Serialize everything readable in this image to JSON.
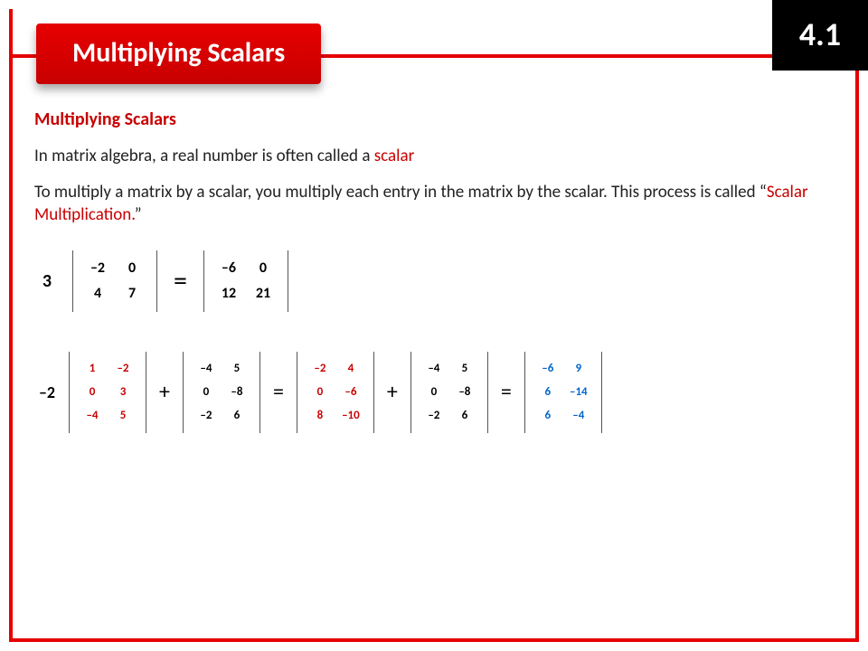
{
  "header": {
    "title": "Multiplying Scalars",
    "section": "4.1"
  },
  "content": {
    "subhead": "Multiplying Scalars",
    "para1_a": "In matrix algebra, a real number is often called a ",
    "para1_scalar": "scalar",
    "para2_a": "To multiply a matrix by a scalar, you multiply each entry in the matrix by the scalar.  This process is called “",
    "para2_term": "Scalar Multiplication.",
    "para2_b": "”"
  },
  "eq1": {
    "scalar": "3",
    "A": [
      [
        "–2",
        "0"
      ],
      [
        "4",
        "7"
      ]
    ],
    "eq": "=",
    "R": [
      [
        "–6",
        "0"
      ],
      [
        "12",
        "21"
      ]
    ]
  },
  "eq2": {
    "scalar": "–2",
    "A": [
      [
        "1",
        "–2"
      ],
      [
        "0",
        "3"
      ],
      [
        "–4",
        "5"
      ]
    ],
    "plus1": "+",
    "B": [
      [
        "–4",
        "5"
      ],
      [
        "0",
        "–8"
      ],
      [
        "–2",
        "6"
      ]
    ],
    "eq1": "=",
    "C": [
      [
        "–2",
        "4"
      ],
      [
        "0",
        "–6"
      ],
      [
        "8",
        "–10"
      ]
    ],
    "plus2": "+",
    "D": [
      [
        "–4",
        "5"
      ],
      [
        "0",
        "–8"
      ],
      [
        "–2",
        "6"
      ]
    ],
    "eq2": "=",
    "E": [
      [
        "–6",
        "9"
      ],
      [
        "6",
        "–14"
      ],
      [
        "6",
        "–4"
      ]
    ]
  }
}
